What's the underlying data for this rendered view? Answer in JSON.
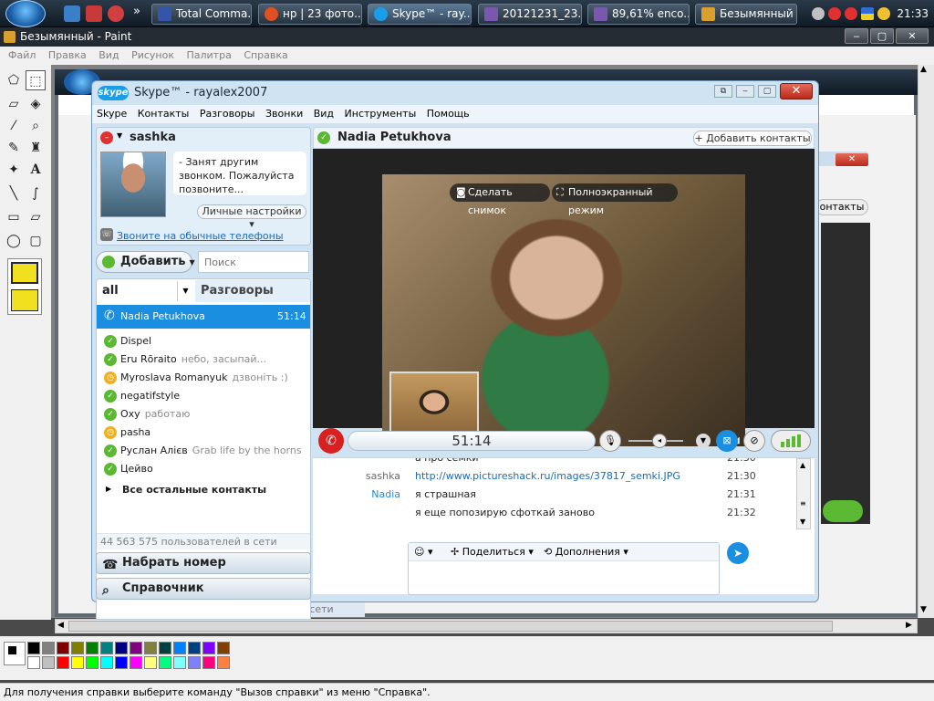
{
  "taskbar": {
    "tasks": [
      {
        "label": "Total Comma..."
      },
      {
        "label": "нр | 23 фото..."
      },
      {
        "label": "Skype™ - ray..."
      },
      {
        "label": "20121231_23..."
      },
      {
        "label": "89,61% enco..."
      },
      {
        "label": "Безымянный ..."
      }
    ],
    "overflow": "»",
    "clock": "21:33"
  },
  "paint": {
    "title": "Безымянный - Paint",
    "menu": [
      "Файл",
      "Правка",
      "Вид",
      "Рисунок",
      "Палитра",
      "Справка"
    ],
    "status": "Для получения справки выберите команду \"Вызов справки\" из меню \"Справка\".",
    "palette_top": [
      "#000000",
      "#808080",
      "#800000",
      "#808000",
      "#008000",
      "#008080",
      "#000080",
      "#800080",
      "#808040",
      "#004040",
      "#0080ff",
      "#004080",
      "#8000ff",
      "#804000"
    ],
    "palette_bottom": [
      "#ffffff",
      "#c0c0c0",
      "#ff0000",
      "#ffff00",
      "#00ff00",
      "#00ffff",
      "#0000ff",
      "#ff00ff",
      "#ffff80",
      "#00ff80",
      "#80ffff",
      "#8080ff",
      "#ff0080",
      "#ff8040"
    ],
    "window_controls": [
      "‒",
      "▢",
      "✕"
    ]
  },
  "skype": {
    "title": "Skype™ - rayalex2007",
    "logo": "skype",
    "menu": [
      "Skype",
      "Контакты",
      "Разговоры",
      "Звонки",
      "Вид",
      "Инструменты",
      "Помощь"
    ],
    "profile": {
      "name": "sashka",
      "mood": "- Занят другим звонком. Пожалуйста позвоните...",
      "settings_btn": "Личные настройки"
    },
    "phone_link": "Звоните на обычные телефоны",
    "add_btn": "Добавить",
    "search_placeholder": "Поиск",
    "filter": "all",
    "tab_conversations": "Разговоры",
    "active_call": {
      "name": "Nadia  Petukhova",
      "time": "51:14"
    },
    "contacts": [
      {
        "name": "Dispel",
        "mood": "",
        "status": "online"
      },
      {
        "name": "Eru Rōraito",
        "mood": "небо, засыпай...",
        "status": "online"
      },
      {
        "name": "Myroslava Romanyuk",
        "mood": "дзвоніть :)",
        "status": "away"
      },
      {
        "name": "negatifstyle",
        "mood": "",
        "status": "online"
      },
      {
        "name": "Oxy",
        "mood": "работаю",
        "status": "online"
      },
      {
        "name": "pasha",
        "mood": "",
        "status": "away"
      },
      {
        "name": "Руслан Алієв",
        "mood": "Grab life by the horns",
        "status": "online"
      },
      {
        "name": "Цейво",
        "mood": "",
        "status": "online"
      }
    ],
    "other_contacts": "Все остальные контакты",
    "online_count": "44 563 575 пользователей в сети",
    "dial_btn": "Набрать номер",
    "directory_btn": "Справочник",
    "call_header": {
      "name": "Nadia  Petukhova",
      "add_contacts": "Добавить контакты"
    },
    "video": {
      "snapshot": "Сделать снимок",
      "fullscreen": "Полноэкранный режим"
    },
    "call_timer": "51:14",
    "chat": [
      {
        "who": "",
        "text": "а про семки",
        "time": "21:30"
      },
      {
        "who": "sashka",
        "text": "http://www.pictureshack.ru/images/37817_semki.JPG",
        "time": "21:30"
      },
      {
        "who": "Nadia",
        "text": "я страшная",
        "time": "21:31"
      },
      {
        "who": "",
        "text": "я еще попозирую сфоткай заново",
        "time": "21:32"
      }
    ],
    "compose": {
      "share": "Поделиться",
      "more": "Дополнения"
    },
    "colors": {
      "accent": "#1a8ee0",
      "online": "#5ab832",
      "away": "#f0b020",
      "end_call": "#d92020"
    }
  },
  "background_window": {
    "add_contacts_fragment": "онтакты",
    "online_count": "44 563 575 пользователей в сети"
  }
}
